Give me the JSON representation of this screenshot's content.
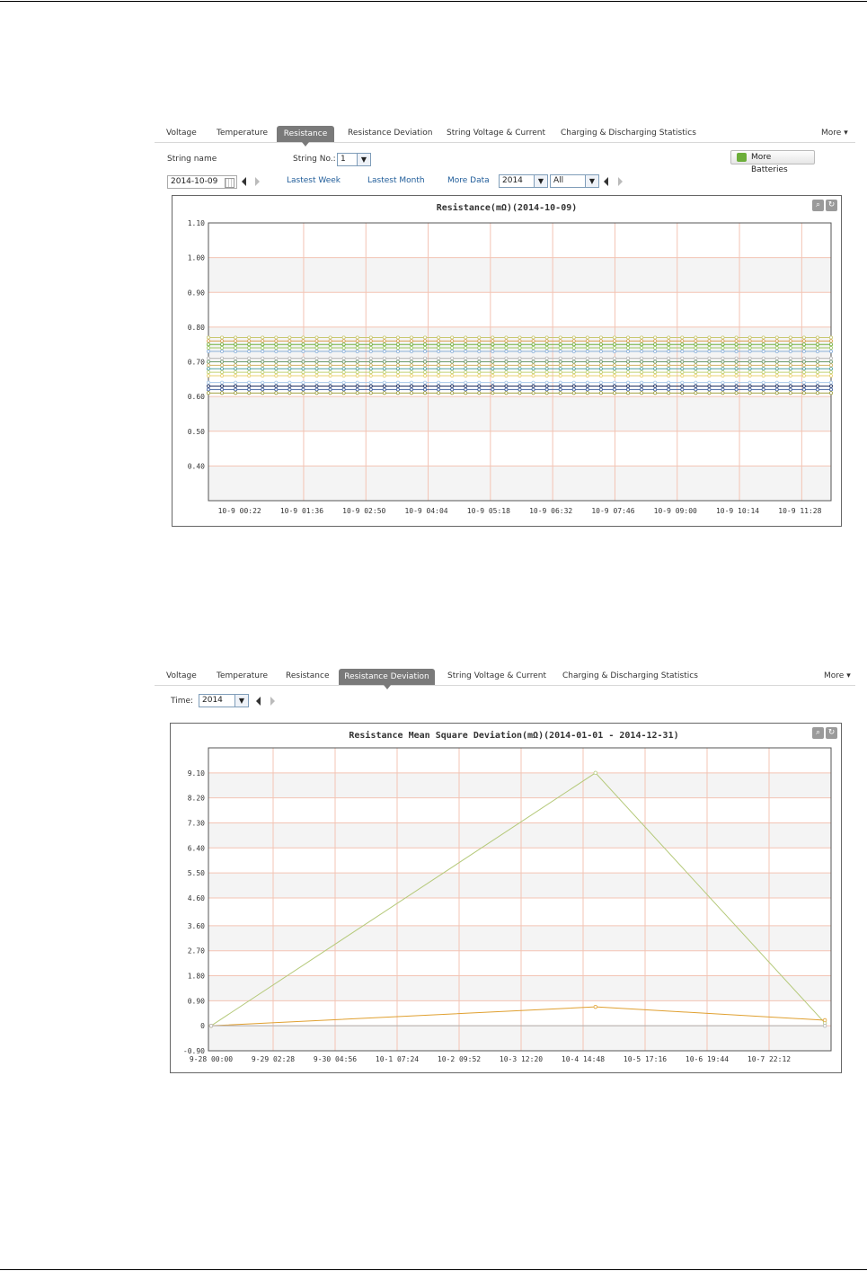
{
  "panel1": {
    "tabs": [
      "Voltage",
      "Temperature",
      "Resistance",
      "Resistance Deviation",
      "String Voltage & Current",
      "Charging & Discharging Statistics"
    ],
    "active_tab": "Resistance",
    "more_label": "More",
    "string_name_label": "String name",
    "string_no_label": "String No.:",
    "string_no_value": "1",
    "more_batteries_label": "More Batteries",
    "date_value": "2014-10-09",
    "links": [
      "Lastest Week",
      "Lastest Month",
      "More Data"
    ],
    "year_value": "2014",
    "range_value": "All",
    "colors": {
      "accent": "#7a7a7a",
      "link": "#1f5c99"
    },
    "icons": [
      "calendar-icon",
      "prev-arrow-icon",
      "next-arrow-icon",
      "zoom-icon",
      "refresh-icon",
      "more-batteries-icon"
    ]
  },
  "panel2": {
    "tabs": [
      "Voltage",
      "Temperature",
      "Resistance",
      "Resistance Deviation",
      "String Voltage & Current",
      "Charging & Discharging Statistics"
    ],
    "active_tab": "Resistance Deviation",
    "more_label": "More",
    "time_label": "Time:",
    "year_value": "2014"
  },
  "chart_data": [
    {
      "type": "line",
      "title": "Resistance(mΩ)(2014-10-09)",
      "ylim": [
        0.3,
        1.1
      ],
      "y_ticks": [
        "1.10",
        "1.00",
        "0.90",
        "0.80",
        "0.70",
        "0.60",
        "0.50",
        "0.40"
      ],
      "x_ticks": [
        "10-9 00:22",
        "10-9 01:36",
        "10-9 02:50",
        "10-9 04:04",
        "10-9 05:18",
        "10-9 06:32",
        "10-9 07:46",
        "10-9 09:00",
        "10-9 10:14",
        "10-9 11:28"
      ],
      "grid": true,
      "points_per_series": 47,
      "series": [
        {
          "values_constant": 0.77,
          "color": "#c8c870"
        },
        {
          "values_constant": 0.76,
          "color": "#d8a050"
        },
        {
          "values_constant": 0.75,
          "color": "#70b040"
        },
        {
          "values_constant": 0.74,
          "color": "#a0c860"
        },
        {
          "values_constant": 0.73,
          "color": "#8ab0d8"
        },
        {
          "values_constant": 0.71,
          "color": "#b8b8b8"
        },
        {
          "values_constant": 0.7,
          "color": "#6a9a6a"
        },
        {
          "values_constant": 0.69,
          "color": "#d0b060"
        },
        {
          "values_constant": 0.68,
          "color": "#50a0a0"
        },
        {
          "values_constant": 0.67,
          "color": "#c0d070"
        },
        {
          "values_constant": 0.66,
          "color": "#e8d070"
        },
        {
          "values_constant": 0.64,
          "color": "#a8c8e8"
        },
        {
          "values_constant": 0.63,
          "color": "#203060"
        },
        {
          "values_constant": 0.62,
          "color": "#4060a0"
        },
        {
          "values_constant": 0.61,
          "color": "#a0a040"
        }
      ]
    },
    {
      "type": "line",
      "title": "Resistance Mean Square Deviation(mΩ)(2014-01-01 - 2014-12-31)",
      "ylim": [
        -0.9,
        10.0
      ],
      "y_ticks": [
        "9.10",
        "8.20",
        "7.30",
        "6.40",
        "5.50",
        "4.60",
        "3.60",
        "2.70",
        "1.80",
        "0.90",
        "0",
        "-0.90"
      ],
      "x": [
        "9-28 00:00",
        "9-29 02:28",
        "9-30 04:56",
        "10-1 07:24",
        "10-2 09:52",
        "10-3 12:20",
        "10-4 14:48",
        "10-5 17:16",
        "10-6 19:44",
        "10-7 22:12"
      ],
      "grid": true,
      "series": [
        {
          "x": [
            0,
            6.2,
            9.9
          ],
          "values": [
            0,
            9.1,
            0.1
          ],
          "color": "#b5c97a"
        },
        {
          "x": [
            0,
            6.2,
            9.9
          ],
          "values": [
            0,
            0.68,
            0.2
          ],
          "color": "#e0a030"
        },
        {
          "x": [
            0,
            9.9
          ],
          "values": [
            0,
            0
          ],
          "color": "#b0b0b0"
        }
      ]
    }
  ]
}
